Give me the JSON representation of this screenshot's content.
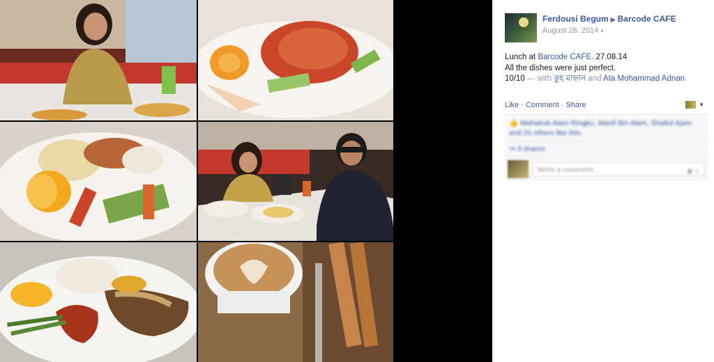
{
  "photo": {
    "tiles": [
      {
        "name": "tile-woman-phone"
      },
      {
        "name": "tile-salad-dish"
      },
      {
        "name": "tile-chicken-plate"
      },
      {
        "name": "tile-couple-table"
      },
      {
        "name": "tile-steak-plate"
      },
      {
        "name": "tile-latte-cup"
      }
    ]
  },
  "post": {
    "author": "Ferdousi Begum",
    "place": "Barcode CAFE",
    "date": "August 28, 2014",
    "text_prefix": "Lunch at ",
    "place_link": "Barcode CAFE",
    "text_date": ". 27.08.14",
    "line2": "All the dishes were just perfect.",
    "rating": "10/10",
    "with_text": " — with ",
    "tag1": "কুহ মাহ্নান",
    "and_text": " and ",
    "tag2": "Ata Mohammad Adnan",
    "end": "."
  },
  "actions": {
    "like": "Like",
    "comment": "Comment",
    "share": "Share",
    "dot": " · "
  },
  "ufi": {
    "likes": "Mahabub Alam Ringku, Manif Bin Alam, Shafiul Ajam and 25 others like this.",
    "shares": "3 shares",
    "comment_placeholder": "Write a comment..."
  },
  "icons": {
    "globe": "globe-icon",
    "audience": "audience-selector-icon",
    "like_thumb": "thumb-up-icon",
    "share": "share-icon",
    "camera": "camera-icon",
    "emoji": "emoji-icon"
  }
}
